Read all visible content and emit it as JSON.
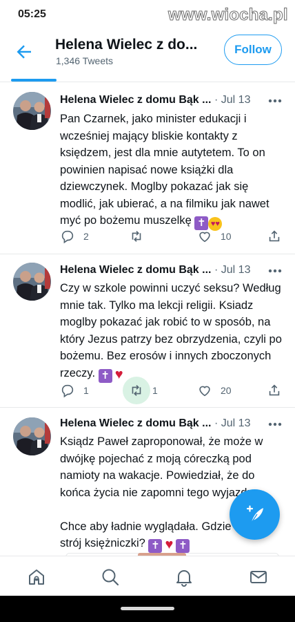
{
  "status_bar": {
    "time": "05:25",
    "watermark": "www.wiocha.pl"
  },
  "header": {
    "title": "Helena Wielec z do...",
    "tweet_count": "1,346 Tweets",
    "follow_label": "Follow"
  },
  "tweets": [
    {
      "name": "Helena Wielec z domu Bąk ...",
      "date": "· Jul 13",
      "text": "Pan Czarnek, jako minister edukacji i wcześniej mający bliskie kontakty z księdzem, jest dla mnie autytetem. To on powinien napisać nowe książki dla dziewczynek. Moglby pokazać jak się modlić, jak ubierać, a na filmiku jak nawet myć po bożemu muszelkę",
      "emojis": [
        "cross-emoji",
        "heart-eyes-emoji"
      ],
      "replies": "2",
      "retweets": "",
      "likes": "10"
    },
    {
      "name": "Helena Wielec z domu Bąk ...",
      "date": "· Jul 13",
      "text": "Czy w szkole powinni uczyć seksu? Według mnie tak. Tylko ma lekcji religii. Ksiadz moglby pokazać jak robić to w sposób, na który Jezus patrzy bez obrzydzenia, czyli po bożemu. Bez erosów i innych zboczonych rzeczy.",
      "emojis": [
        "cross-emoji",
        "heart-emoji"
      ],
      "replies": "1",
      "retweets": "1",
      "likes": "20"
    },
    {
      "name": "Helena Wielec z domu Bąk ...",
      "date": "· Jul 13",
      "text": "Ksiądz Paweł zaproponował, że może w dwójkę pojechać z moją córeczką pod namioty na wakacje. Powiedział, że do końca życia nie zapomni tego wyjazdu.\n\nChce aby ładnie wyglądała. Gdzie kupić strój księżniczki?",
      "emojis": [
        "cross-emoji",
        "heart-emoji",
        "cross-emoji"
      ]
    }
  ],
  "colors": {
    "accent": "#1d9bf0",
    "retweet_highlight": "#d9f2e4",
    "text_secondary": "#536471"
  },
  "nav": [
    "home-icon",
    "search-icon",
    "notifications-icon",
    "messages-icon"
  ]
}
